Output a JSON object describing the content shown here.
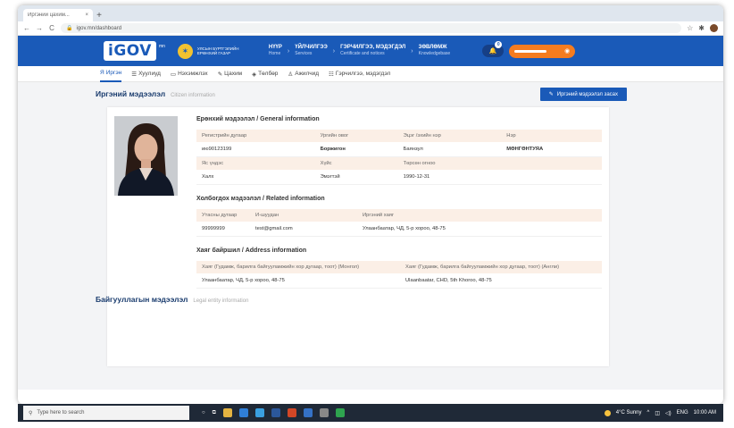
{
  "browser": {
    "tab_title": "Иргэний цахим...",
    "tab_close": "×",
    "new_tab": "+",
    "url": "igov.mn/dashboard",
    "back": "←",
    "forward": "→",
    "reload": "C"
  },
  "header": {
    "logo": "iGOV",
    "logo_sup": "mn",
    "agency": "Улсын бүртгэлийн ерөнхий газар",
    "nav": [
      {
        "label": "НҮҮР",
        "sub": "Home"
      },
      {
        "label": "ҮЙЛЧИЛГЭЭ",
        "sub": "Services"
      },
      {
        "label": "ГЭРЧИЛГЭЭ, МЭДЭГДЭЛ",
        "sub": "Certificate and notices"
      },
      {
        "label": "ЗӨВЛӨМЖ",
        "sub": "Knowledgebase"
      }
    ],
    "notif_count": "0"
  },
  "subnav": [
    {
      "icon": "Я",
      "label": "Иргэн"
    },
    {
      "icon": "☰",
      "label": "Хуулиуд"
    },
    {
      "icon": "▭",
      "label": "Нэхэмжлэх"
    },
    {
      "icon": "✎",
      "label": "Цахим"
    },
    {
      "icon": "◈",
      "label": "Төлбөр"
    },
    {
      "icon": "♙",
      "label": "Ажилчид"
    },
    {
      "icon": "☷",
      "label": "Гэрчилгээ, мэдэгдэл"
    }
  ],
  "section": {
    "title": "Иргэний мэдээлэл",
    "title_en": "Citizen information",
    "edit_button": "Иргэний мэдээлэл засах"
  },
  "general": {
    "heading": "Ерөнхий мэдээлэл / General information",
    "h1": [
      "Регистрийн дугаар",
      "Ургийн овог",
      "Эцэг /эхийн нэр",
      "Нэр"
    ],
    "r1": [
      "ию90123199",
      "Боржигон",
      "Баянзул",
      "МӨНГӨНТУЯА"
    ],
    "h2": [
      "Яс үндэс",
      "Хүйс",
      "Төрсөн огноо"
    ],
    "r2": [
      "Халх",
      "Эмэгтэй",
      "1990-12-31"
    ]
  },
  "related": {
    "heading": "Холбогдох мэдээлэл / Related information",
    "h": [
      "Утасны дугаар",
      "И-шуудан",
      "Иргэний хаяг"
    ],
    "r": [
      "99999999",
      "test@gmail.com",
      "Улаанбаатар, ЧД, 5-р хороо, 48-75"
    ]
  },
  "address": {
    "heading": "Хаяг байршил / Address information",
    "h": [
      "Хаяг (Гудамж, барилга байгууламжийн хор дугаар, тоот) (Монгол)",
      "Хаяг (Гудамж, барилга байгууламжийн хор дугаар, тоот) (Англи)"
    ],
    "r": [
      "Улаанбаатар, ЧД, 5-р хороо, 48-75",
      "Ulaanbaatar, CHD, 5th Khoroo, 48-75"
    ]
  },
  "legal": {
    "title": "Байгууллагын мэдээлэл",
    "title_en": "Legal entity information"
  },
  "taskbar": {
    "search_placeholder": "Type here to search",
    "weather": "4°C  Sunny",
    "lang": "ENG",
    "time": "10:00 AM"
  }
}
